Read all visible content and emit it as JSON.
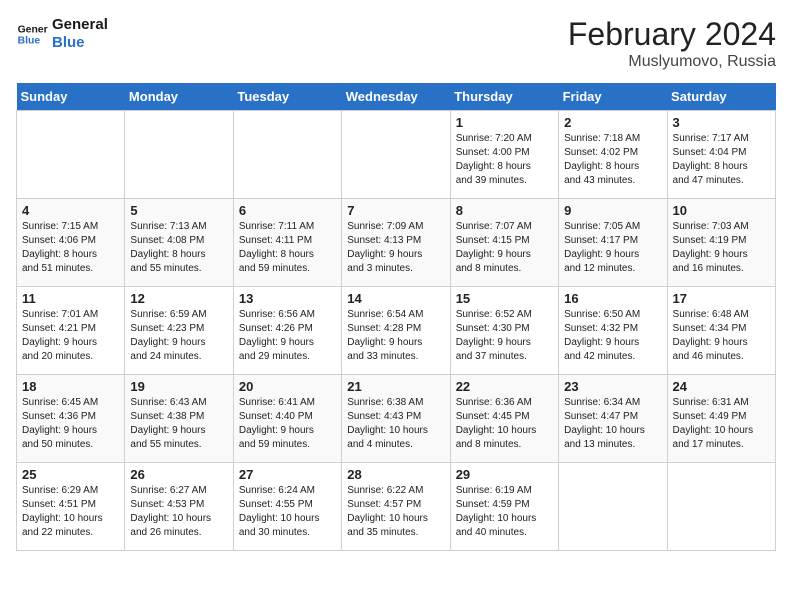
{
  "header": {
    "logo_line1": "General",
    "logo_line2": "Blue",
    "month_year": "February 2024",
    "location": "Muslyumovo, Russia"
  },
  "weekdays": [
    "Sunday",
    "Monday",
    "Tuesday",
    "Wednesday",
    "Thursday",
    "Friday",
    "Saturday"
  ],
  "weeks": [
    [
      {
        "day": "",
        "info": ""
      },
      {
        "day": "",
        "info": ""
      },
      {
        "day": "",
        "info": ""
      },
      {
        "day": "",
        "info": ""
      },
      {
        "day": "1",
        "info": "Sunrise: 7:20 AM\nSunset: 4:00 PM\nDaylight: 8 hours\nand 39 minutes."
      },
      {
        "day": "2",
        "info": "Sunrise: 7:18 AM\nSunset: 4:02 PM\nDaylight: 8 hours\nand 43 minutes."
      },
      {
        "day": "3",
        "info": "Sunrise: 7:17 AM\nSunset: 4:04 PM\nDaylight: 8 hours\nand 47 minutes."
      }
    ],
    [
      {
        "day": "4",
        "info": "Sunrise: 7:15 AM\nSunset: 4:06 PM\nDaylight: 8 hours\nand 51 minutes."
      },
      {
        "day": "5",
        "info": "Sunrise: 7:13 AM\nSunset: 4:08 PM\nDaylight: 8 hours\nand 55 minutes."
      },
      {
        "day": "6",
        "info": "Sunrise: 7:11 AM\nSunset: 4:11 PM\nDaylight: 8 hours\nand 59 minutes."
      },
      {
        "day": "7",
        "info": "Sunrise: 7:09 AM\nSunset: 4:13 PM\nDaylight: 9 hours\nand 3 minutes."
      },
      {
        "day": "8",
        "info": "Sunrise: 7:07 AM\nSunset: 4:15 PM\nDaylight: 9 hours\nand 8 minutes."
      },
      {
        "day": "9",
        "info": "Sunrise: 7:05 AM\nSunset: 4:17 PM\nDaylight: 9 hours\nand 12 minutes."
      },
      {
        "day": "10",
        "info": "Sunrise: 7:03 AM\nSunset: 4:19 PM\nDaylight: 9 hours\nand 16 minutes."
      }
    ],
    [
      {
        "day": "11",
        "info": "Sunrise: 7:01 AM\nSunset: 4:21 PM\nDaylight: 9 hours\nand 20 minutes."
      },
      {
        "day": "12",
        "info": "Sunrise: 6:59 AM\nSunset: 4:23 PM\nDaylight: 9 hours\nand 24 minutes."
      },
      {
        "day": "13",
        "info": "Sunrise: 6:56 AM\nSunset: 4:26 PM\nDaylight: 9 hours\nand 29 minutes."
      },
      {
        "day": "14",
        "info": "Sunrise: 6:54 AM\nSunset: 4:28 PM\nDaylight: 9 hours\nand 33 minutes."
      },
      {
        "day": "15",
        "info": "Sunrise: 6:52 AM\nSunset: 4:30 PM\nDaylight: 9 hours\nand 37 minutes."
      },
      {
        "day": "16",
        "info": "Sunrise: 6:50 AM\nSunset: 4:32 PM\nDaylight: 9 hours\nand 42 minutes."
      },
      {
        "day": "17",
        "info": "Sunrise: 6:48 AM\nSunset: 4:34 PM\nDaylight: 9 hours\nand 46 minutes."
      }
    ],
    [
      {
        "day": "18",
        "info": "Sunrise: 6:45 AM\nSunset: 4:36 PM\nDaylight: 9 hours\nand 50 minutes."
      },
      {
        "day": "19",
        "info": "Sunrise: 6:43 AM\nSunset: 4:38 PM\nDaylight: 9 hours\nand 55 minutes."
      },
      {
        "day": "20",
        "info": "Sunrise: 6:41 AM\nSunset: 4:40 PM\nDaylight: 9 hours\nand 59 minutes."
      },
      {
        "day": "21",
        "info": "Sunrise: 6:38 AM\nSunset: 4:43 PM\nDaylight: 10 hours\nand 4 minutes."
      },
      {
        "day": "22",
        "info": "Sunrise: 6:36 AM\nSunset: 4:45 PM\nDaylight: 10 hours\nand 8 minutes."
      },
      {
        "day": "23",
        "info": "Sunrise: 6:34 AM\nSunset: 4:47 PM\nDaylight: 10 hours\nand 13 minutes."
      },
      {
        "day": "24",
        "info": "Sunrise: 6:31 AM\nSunset: 4:49 PM\nDaylight: 10 hours\nand 17 minutes."
      }
    ],
    [
      {
        "day": "25",
        "info": "Sunrise: 6:29 AM\nSunset: 4:51 PM\nDaylight: 10 hours\nand 22 minutes."
      },
      {
        "day": "26",
        "info": "Sunrise: 6:27 AM\nSunset: 4:53 PM\nDaylight: 10 hours\nand 26 minutes."
      },
      {
        "day": "27",
        "info": "Sunrise: 6:24 AM\nSunset: 4:55 PM\nDaylight: 10 hours\nand 30 minutes."
      },
      {
        "day": "28",
        "info": "Sunrise: 6:22 AM\nSunset: 4:57 PM\nDaylight: 10 hours\nand 35 minutes."
      },
      {
        "day": "29",
        "info": "Sunrise: 6:19 AM\nSunset: 4:59 PM\nDaylight: 10 hours\nand 40 minutes."
      },
      {
        "day": "",
        "info": ""
      },
      {
        "day": "",
        "info": ""
      }
    ]
  ]
}
